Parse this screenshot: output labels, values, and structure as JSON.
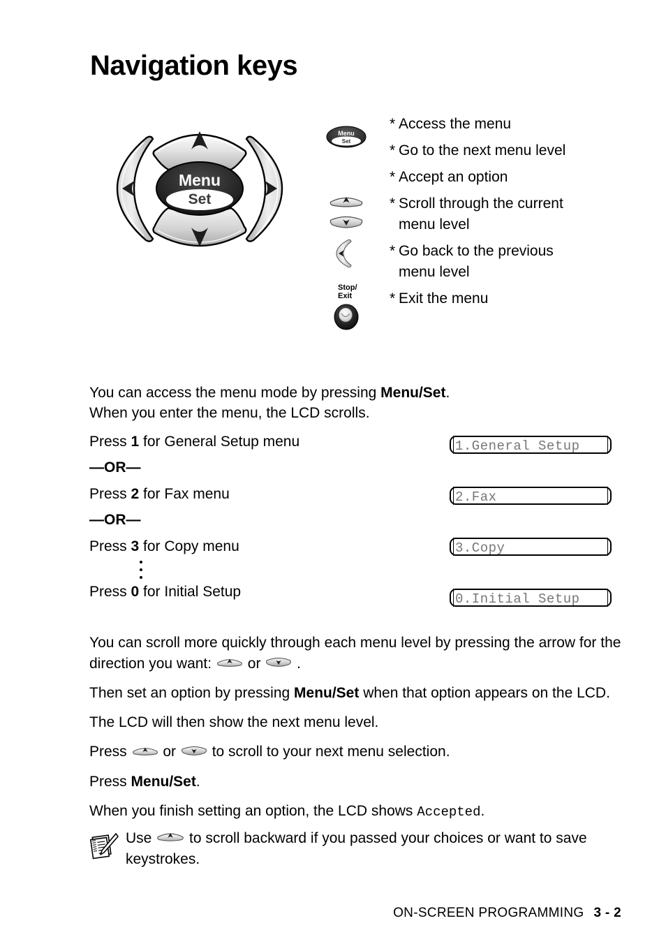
{
  "page": {
    "title": "Navigation keys",
    "footer_section": "ON-SCREEN PROGRAMMING",
    "footer_page": "3 - 2"
  },
  "navkeys": {
    "center_label_top": "Menu",
    "center_label_bottom": "Set",
    "up_icon": "up-arrow-key",
    "down_icon": "down-arrow-key",
    "left_icon": "left-arrow-key",
    "right_icon": "right-arrow-key"
  },
  "legend": {
    "icons": [
      {
        "name": "menu-set-key",
        "label_top": "Menu",
        "label_bottom": "Set"
      },
      {
        "name": "up-arrow-key"
      },
      {
        "name": "down-arrow-key"
      },
      {
        "name": "left-arrow-key"
      },
      {
        "name": "stop-exit-key",
        "label_top": "Stop/",
        "label_bottom": "Exit"
      }
    ],
    "bullets": [
      {
        "star": "*",
        "text": "Access the menu"
      },
      {
        "star": "*",
        "text": "Go to the next menu level"
      },
      {
        "star": "*",
        "text": "Accept an option"
      },
      {
        "star": "*",
        "text": "Scroll through the current menu level"
      },
      {
        "star": "*",
        "text": "Go back to the previous menu level"
      },
      {
        "star": "*",
        "text": "Exit the menu"
      }
    ]
  },
  "body": {
    "intro_line1_a": "You can access the menu mode by pressing ",
    "intro_line1_b": "Menu/Set",
    "intro_line1_c": ".",
    "intro_line2": "When you enter the menu, the LCD scrolls.",
    "press1_a": "Press ",
    "press1_num": "1",
    "press1_b": " for General Setup menu",
    "or1": "—OR—",
    "press2_a": "Press ",
    "press2_num": "2",
    "press2_b": " for Fax menu",
    "or2": "—OR—",
    "press3_a": "Press ",
    "press3_num": "3",
    "press3_b": " for Copy menu",
    "press0_a": "Press ",
    "press0_num": "0",
    "press0_b": " for Initial Setup"
  },
  "lcd_boxes": [
    {
      "name": "lcd-general-setup",
      "text": "1.General Setup"
    },
    {
      "name": "lcd-fax",
      "text": "2.Fax"
    },
    {
      "name": "lcd-copy",
      "text": "3.Copy"
    },
    {
      "name": "lcd-initial-setup",
      "text": "0.Initial Setup"
    }
  ],
  "lower": {
    "p1_a": "You can scroll more quickly through each menu level by pressing the arrow for the direction you want: ",
    "p1_or": " or ",
    "p1_end": " .",
    "p2_a": "Then set an option by pressing ",
    "p2_b": "Menu/Set",
    "p2_c": " when that option appears on the LCD.",
    "p3": "The LCD will then show the next menu level.",
    "p4_a": "Press ",
    "p4_or": " or ",
    "p4_b": " to scroll to your next menu selection.",
    "p5_a": "Press ",
    "p5_b": "Menu/Set",
    "p5_c": ".",
    "p6_a": "When you finish setting an option, the LCD shows ",
    "p6_mono": "Accepted",
    "p6_c": "."
  },
  "note": {
    "icon": "note-pencil-icon",
    "text_a": "Use ",
    "text_b": " to scroll backward if you passed your choices or want to save keystrokes."
  },
  "colors": {
    "ink": "#000000",
    "lcd_text": "#777777",
    "key_light": "#e9e9e9",
    "key_mid": "#bdbdbd",
    "key_dark": "#2b2b2b"
  }
}
